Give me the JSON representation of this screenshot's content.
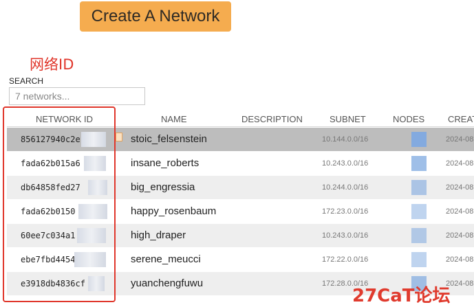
{
  "create_button": {
    "label": "Create A Network"
  },
  "annotation": {
    "label": "网络ID"
  },
  "search": {
    "label": "SEARCH",
    "placeholder": "7 networks..."
  },
  "columns": {
    "network_id": "NETWORK ID",
    "name": "NAME",
    "description": "DESCRIPTION",
    "subnet": "SUBNET",
    "nodes": "NODES",
    "created": "CREAT"
  },
  "rows": [
    {
      "id": "856127940c2e",
      "name": "stoic_felsenstein",
      "description": "",
      "subnet": "10.144.0.0/16",
      "created": "2024-08"
    },
    {
      "id": "fada62b015a6",
      "name": "insane_roberts",
      "description": "",
      "subnet": "10.243.0.0/16",
      "created": "2024-08"
    },
    {
      "id": "db64858fed27",
      "name": "big_engressia",
      "description": "",
      "subnet": "10.244.0.0/16",
      "created": "2024-08"
    },
    {
      "id": "fada62b0150",
      "name": "happy_rosenbaum",
      "description": "",
      "subnet": "172.23.0.0/16",
      "created": "2024-08"
    },
    {
      "id": "60ee7c034a1",
      "name": "high_draper",
      "description": "",
      "subnet": "10.243.0.0/16",
      "created": "2024-08"
    },
    {
      "id": "ebe7fbd4454",
      "name": "serene_meucci",
      "description": "",
      "subnet": "172.22.0.0/16",
      "created": "2024-08"
    },
    {
      "id": "e3918db4836cf",
      "name": "yuanchengfuwu",
      "description": "",
      "subnet": "172.28.0.0/16",
      "created": "2024-08"
    }
  ],
  "watermark": {
    "text": "27CaT论坛"
  },
  "colors": {
    "button": "#f5ac4f",
    "annotation": "#e0362b",
    "selected_row": "#bdbdbd",
    "alt_row": "#eeeeee",
    "node_icon": "#7fa9e0"
  },
  "icons": {
    "nodes": "node-square-icon",
    "row_note": "document-icon"
  }
}
